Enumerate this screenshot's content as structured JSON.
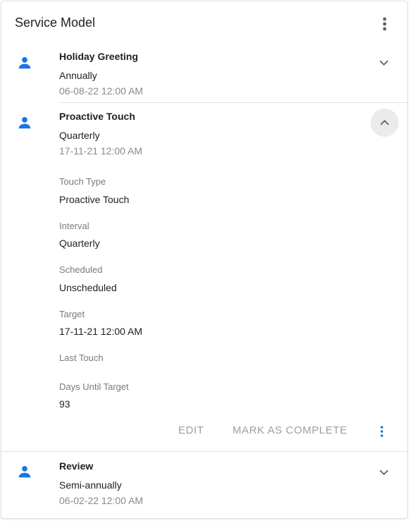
{
  "header": {
    "title": "Service Model",
    "menu_icon": "more-vert-icon"
  },
  "colors": {
    "accent": "#1a73e8",
    "muted": "#8a8a8a"
  },
  "items": [
    {
      "title": "Holiday Greeting",
      "frequency": "Annually",
      "date": "06-08-22 12:00 AM",
      "expanded": false
    },
    {
      "title": "Proactive Touch",
      "frequency": "Quarterly",
      "date": "17-11-21 12:00 AM",
      "expanded": true
    },
    {
      "title": "Review",
      "frequency": "Semi-annually",
      "date": "06-02-22 12:00 AM",
      "expanded": false
    }
  ],
  "details": {
    "touch_type_label": "Touch Type",
    "touch_type_value": "Proactive Touch",
    "interval_label": "Interval",
    "interval_value": "Quarterly",
    "scheduled_label": "Scheduled",
    "scheduled_value": "Unscheduled",
    "target_label": "Target",
    "target_value": "17-11-21 12:00 AM",
    "last_touch_label": "Last Touch",
    "last_touch_value": "",
    "days_label": "Days Until Target",
    "days_value": "93"
  },
  "actions": {
    "edit_label": "EDIT",
    "complete_label": "MARK AS COMPLETE"
  }
}
